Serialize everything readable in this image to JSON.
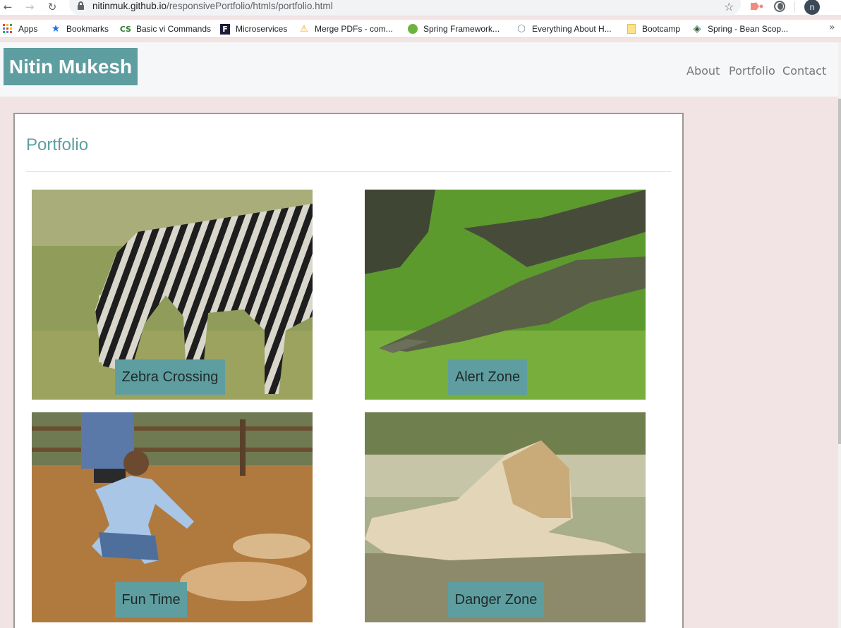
{
  "browser": {
    "url_host": "nitinmuk.github.io",
    "url_path": "/responsivePortfolio/htmls/portfolio.html",
    "profile_initial": "n",
    "bookmarks": [
      {
        "label": "Apps",
        "icon": "apps-grid-icon"
      },
      {
        "label": "Bookmarks",
        "icon": "star-icon"
      },
      {
        "label": "Basic vi Commands",
        "icon": "cs-icon"
      },
      {
        "label": "Microservices",
        "icon": "f-icon"
      },
      {
        "label": "Merge PDFs - com...",
        "icon": "warning-triangle-icon"
      },
      {
        "label": "Spring Framework...",
        "icon": "spring-leaf-icon"
      },
      {
        "label": "Everything About H...",
        "icon": "hexagon-icon"
      },
      {
        "label": "Bootcamp",
        "icon": "folder-icon"
      },
      {
        "label": "Spring - Bean Scop...",
        "icon": "diamond-icon"
      }
    ]
  },
  "site": {
    "brand": "Nitin Mukesh",
    "nav": [
      "About",
      "Portfolio",
      "Contact"
    ],
    "accent_color": "#5f9ea0"
  },
  "portfolio": {
    "title": "Portfolio",
    "items": [
      {
        "caption": "Zebra Crossing",
        "image": "zebra grazing"
      },
      {
        "caption": "Alert Zone",
        "image": "crocodiles on grass"
      },
      {
        "caption": "Fun Time",
        "image": "man with lion cubs"
      },
      {
        "caption": "Danger Zone",
        "image": "lion resting"
      }
    ]
  }
}
